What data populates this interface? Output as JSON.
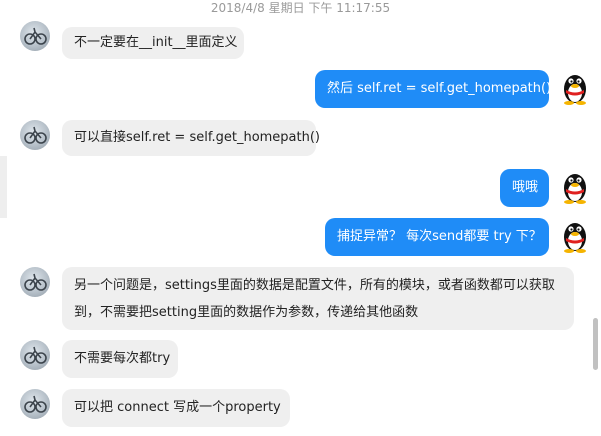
{
  "timestamp": "2018/4/8 星期日 下午 11:17:55",
  "messages": [
    {
      "side": "in",
      "text": "不一定要在__init__里面定义"
    },
    {
      "side": "out",
      "text": "然后 self.ret = self.get_homepath()"
    },
    {
      "side": "in",
      "text": "可以直接self.ret = self.get_homepath()"
    },
    {
      "side": "out",
      "text": "哦哦"
    },
    {
      "side": "out",
      "text": "捕捉异常？ 每次send都要 try 下？"
    },
    {
      "side": "in",
      "text": "另一个问题是，settings里面的数据是配置文件，所有的模块，或者函数都可以获取到，不需要把setting里面的数据作为参数，传递给其他函数"
    },
    {
      "side": "in",
      "text": "不需要每次都try"
    },
    {
      "side": "in",
      "text": "可以把  connect 写成一个property"
    }
  ],
  "colors": {
    "incoming_bubble": "#efefef",
    "outgoing_bubble": "#1f8cf7",
    "timestamp": "#9a9a9a"
  },
  "icons": {
    "contact_avatar": "avatar-icon",
    "self_avatar": "qq-penguin-icon"
  }
}
